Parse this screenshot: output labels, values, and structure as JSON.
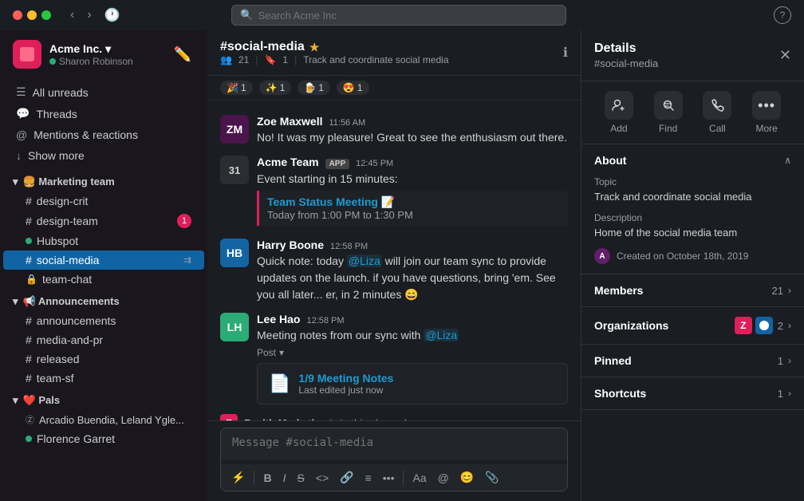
{
  "titlebar": {
    "search_placeholder": "Search Acme Inc",
    "help_label": "?"
  },
  "sidebar": {
    "workspace_name": "Acme Inc.",
    "workspace_user": "Sharon Robinson",
    "nav": {
      "all_unreads": "All unreads",
      "threads": "Threads",
      "mentions": "Mentions & reactions",
      "show_more": "Show more"
    },
    "sections": [
      {
        "label": "🍔 Marketing team",
        "channels": [
          {
            "name": "design-crit",
            "badge": null,
            "type": "hash"
          },
          {
            "name": "design-team",
            "badge": "1",
            "type": "hash"
          },
          {
            "name": "Hubspot",
            "badge": null,
            "type": "dot"
          },
          {
            "name": "social-media",
            "badge": null,
            "type": "hash",
            "active": true,
            "bookmark": true
          },
          {
            "name": "team-chat",
            "badge": null,
            "type": "lock"
          }
        ]
      },
      {
        "label": "📢 Announcements",
        "channels": [
          {
            "name": "announcements",
            "badge": null,
            "type": "hash"
          },
          {
            "name": "media-and-pr",
            "badge": null,
            "type": "hash"
          },
          {
            "name": "released",
            "badge": null,
            "type": "hash"
          },
          {
            "name": "team-sf",
            "badge": null,
            "type": "hash"
          }
        ]
      },
      {
        "label": "❤️ Pals",
        "channels": [
          {
            "name": "Arcadio Buendia, Leland Ygle...",
            "badge": null,
            "type": "dm"
          },
          {
            "name": "Florence Garret",
            "badge": null,
            "type": "dot-green"
          }
        ]
      }
    ]
  },
  "chat": {
    "channel_name": "#social-media",
    "members_count": "21",
    "bookmarks_count": "1",
    "channel_desc": "Track and coordinate social media",
    "emoji_reactions": [
      {
        "emoji": "🎉",
        "count": "1"
      },
      {
        "emoji": "✨",
        "count": "1"
      },
      {
        "emoji": "🍺",
        "count": "1"
      },
      {
        "emoji": "😍",
        "count": "1"
      }
    ],
    "messages": [
      {
        "id": "msg1",
        "author": "Zoe Maxwell",
        "time": "11:56 AM",
        "avatar_type": "zoe",
        "avatar_text": "ZM",
        "text": "No! It was my pleasure! Great to see the enthusiasm out there."
      },
      {
        "id": "msg2",
        "author": "Acme Team",
        "time": "12:45 PM",
        "avatar_type": "acme",
        "avatar_text": "31",
        "is_app": true,
        "event_title": "Team Status Meeting 📝",
        "event_time": "Today from 1:00 PM to 1:30 PM",
        "text": "Event starting in 15 minutes:"
      },
      {
        "id": "msg3",
        "author": "Harry Boone",
        "time": "12:58 PM",
        "avatar_type": "harry",
        "avatar_text": "HB",
        "text": "Quick note: today @Liza will join our team sync to provide updates on the launch. if you have questions, bring 'em. See you all later... er, in 2 minutes 😄"
      },
      {
        "id": "msg4",
        "author": "Lee Hao",
        "time": "12:58 PM",
        "avatar_type": "lee",
        "avatar_text": "LH",
        "text": "Meeting notes from our sync with @Liza",
        "post_label": "Post",
        "post_title": "1/9 Meeting Notes",
        "post_meta": "Last edited just now"
      }
    ],
    "zenith_banner": "Zenith Marketing is in this channel",
    "message_placeholder": "Message #social-media",
    "toolbar_items": [
      "⚡",
      "B",
      "I",
      "S̶",
      "<>",
      "🔗",
      "≡",
      "•••",
      "Aa",
      "@",
      "😊",
      "📎"
    ]
  },
  "details": {
    "title": "Details",
    "channel": "#social-media",
    "actions": [
      {
        "id": "add",
        "icon": "➕👤",
        "label": "Add"
      },
      {
        "id": "find",
        "icon": "🔍≡",
        "label": "Find"
      },
      {
        "id": "call",
        "icon": "📞",
        "label": "Call"
      },
      {
        "id": "more",
        "icon": "•••",
        "label": "More"
      }
    ],
    "about": {
      "topic_label": "Topic",
      "topic_value": "Track and coordinate social media",
      "desc_label": "Description",
      "desc_value": "Home of the social media team",
      "created_label": "Created on October 18th, 2019"
    },
    "sections": [
      {
        "label": "Members",
        "count": "21",
        "chevron": ">"
      },
      {
        "label": "Organizations",
        "count": "2",
        "chevron": ">"
      },
      {
        "label": "Pinned",
        "count": "1 >",
        "chevron": ""
      },
      {
        "label": "Shortcuts",
        "count": "1 >",
        "chevron": ""
      }
    ]
  }
}
